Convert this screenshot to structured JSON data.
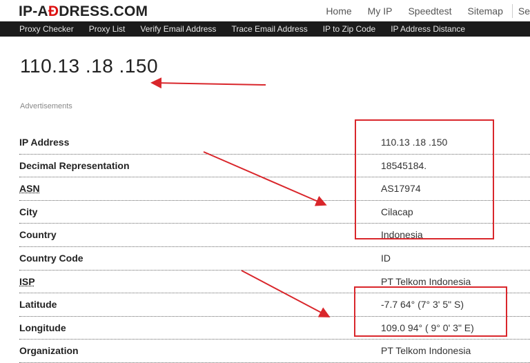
{
  "header": {
    "logo_left": "IP-A",
    "logo_accent": "Đ",
    "logo_right": "DRESS.COM",
    "nav": [
      "Home",
      "My IP",
      "Speedtest",
      "Sitemap",
      "Se"
    ]
  },
  "subnav": [
    "Proxy Checker",
    "Proxy List",
    "Verify Email Address",
    "Trace Email Address",
    "IP to Zip Code",
    "IP Address Distance"
  ],
  "main": {
    "ip_heading": "110.13 .18 .150",
    "ads_label": "Advertisements"
  },
  "rows": [
    {
      "label": "IP Address",
      "value": "110.13 .18 .150"
    },
    {
      "label": "Decimal Representation",
      "value": "18545184."
    },
    {
      "label": "ASN",
      "value": "AS17974"
    },
    {
      "label": "City",
      "value": "Cilacap"
    },
    {
      "label": "Country",
      "value": "Indonesia"
    },
    {
      "label": "Country Code",
      "value": "ID"
    },
    {
      "label": "ISP",
      "value": "PT Telkom Indonesia"
    },
    {
      "label": "Latitude",
      "value": "-7.7 64° (7° 3' 5\" S)"
    },
    {
      "label": "Longitude",
      "value": "109.0 94° ( 9° 0' 3\" E)"
    },
    {
      "label": "Organization",
      "value": "PT Telkom Indonesia"
    }
  ],
  "colors": {
    "annotation": "#d9262b",
    "navbar": "#1b1b1b"
  }
}
